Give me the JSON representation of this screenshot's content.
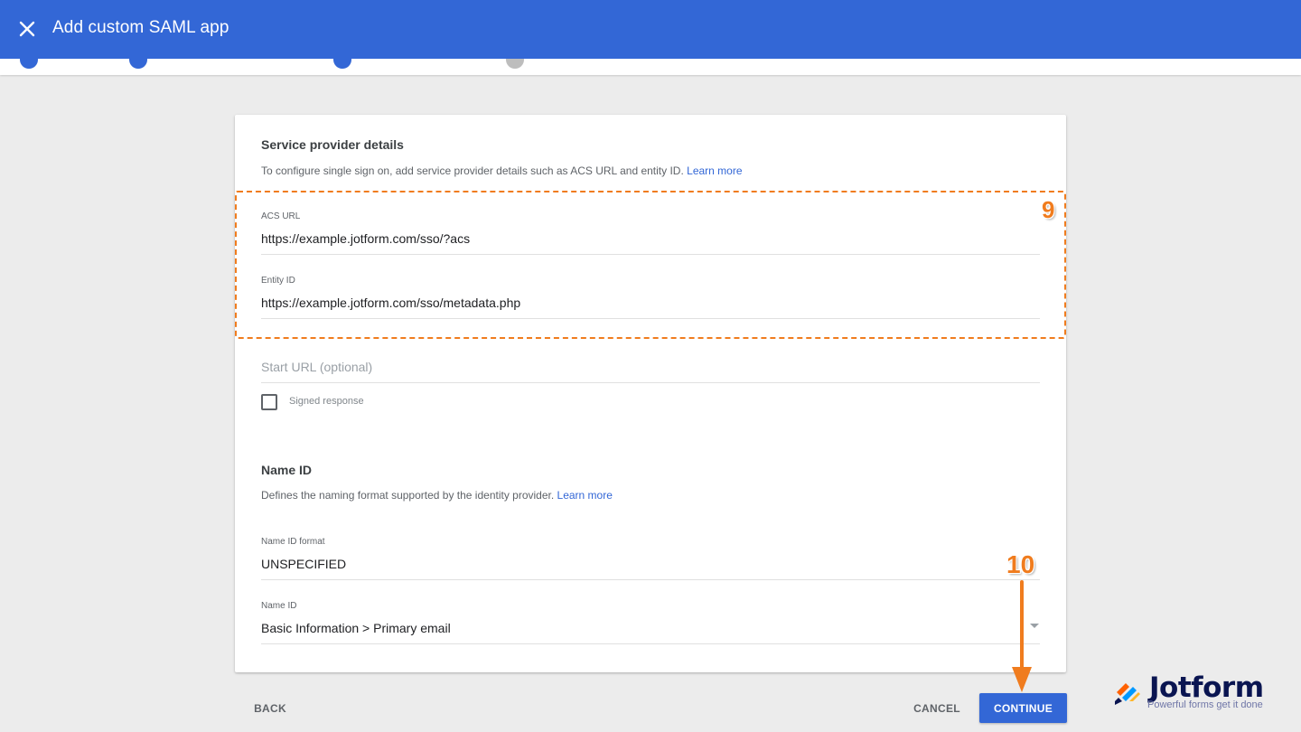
{
  "header": {
    "title": "Add custom SAML app",
    "close_icon": "close-icon"
  },
  "service_provider": {
    "title": "Service provider details",
    "description": "To configure single sign on, add service provider details such as ACS URL and entity ID.",
    "learn_more": "Learn more",
    "acs_url_label": "ACS URL",
    "acs_url_value": "https://example.jotform.com/sso/?acs",
    "entity_id_label": "Entity ID",
    "entity_id_value": "https://example.jotform.com/sso/metadata.php",
    "start_url_placeholder": "Start URL (optional)",
    "signed_response_label": "Signed response",
    "signed_response_checked": false
  },
  "name_id": {
    "title": "Name ID",
    "description": "Defines the naming format supported by the identity provider.",
    "learn_more": "Learn more",
    "format_label": "Name ID format",
    "format_value": "UNSPECIFIED",
    "name_id_label": "Name ID",
    "name_id_value": "Basic Information > Primary email"
  },
  "footer": {
    "back": "BACK",
    "cancel": "CANCEL",
    "continue": "CONTINUE"
  },
  "annotations": {
    "step_9": "9",
    "step_10": "10",
    "color": "#f07c1e"
  },
  "logo": {
    "name": "Jotform",
    "tagline": "Powerful forms get it done"
  },
  "colors": {
    "primary": "#3367d6",
    "background": "#ececec",
    "annotation": "#f07c1e"
  }
}
